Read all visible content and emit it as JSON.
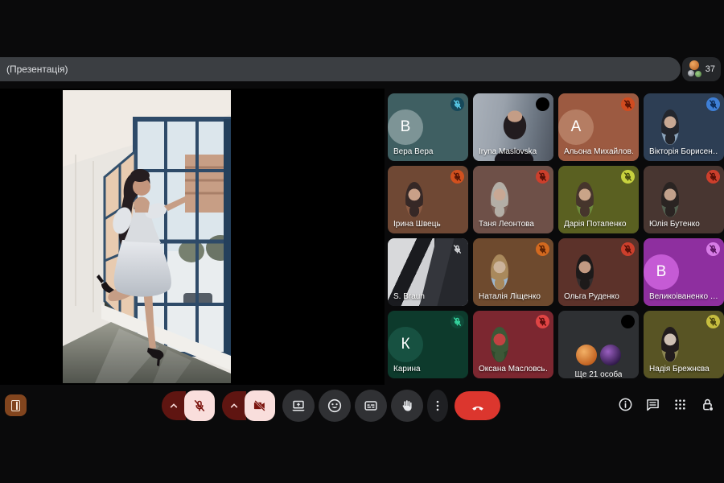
{
  "top_bar": {
    "title": "(Презентація)",
    "participants_count": "37"
  },
  "tiles": [
    {
      "name": "Вера Вера",
      "type": "initial",
      "initial": "В",
      "bg": "#3f5f62",
      "avatar_bg": "#7d9496",
      "badge": {
        "bg": "#16485a",
        "fg": "#58c8e6"
      }
    },
    {
      "name": "Iryna Maslovska",
      "type": "video",
      "video": "maslovska",
      "bg": "#6d7680"
    },
    {
      "name": "Альона Михайлов…",
      "type": "initial",
      "initial": "А",
      "bg": "#9c5a41",
      "avatar_bg": "#b57d63",
      "badge": {
        "bg": "#d14b1f",
        "fg": "#571304"
      }
    },
    {
      "name": "Вікторія Борисен…",
      "type": "photo",
      "bg": "#2d3e54",
      "photo": [
        "#c8a893",
        "#23262d",
        "#8ba3ba"
      ],
      "badge": {
        "bg": "#3e7fd6",
        "fg": "#0c2a56"
      }
    },
    {
      "name": "Ірина Швець",
      "type": "photo",
      "bg": "#6f4834",
      "photo": [
        "#c9a088",
        "#362826",
        "#8a5a42"
      ],
      "badge": {
        "bg": "#d2501e",
        "fg": "#571504"
      }
    },
    {
      "name": "Таня Леонтова",
      "type": "photo",
      "bg": "#6e5048",
      "photo": [
        "#c9a894",
        "#b3aea6",
        "#7c6057"
      ],
      "badge": {
        "bg": "#cc3f2c",
        "fg": "#520f06"
      }
    },
    {
      "name": "Дарія Потапенко",
      "type": "photo",
      "bg": "#5a6021",
      "photo": [
        "#c9a488",
        "#46352c",
        "#6d8a3c"
      ],
      "badge": {
        "bg": "#c8d23e",
        "fg": "#464a0e"
      }
    },
    {
      "name": "Юлія Бутенко",
      "type": "photo",
      "bg": "#483631",
      "photo": [
        "#c2a18b",
        "#2a2422",
        "#526050"
      ],
      "badge": {
        "bg": "#cc3f2c",
        "fg": "#520f06"
      }
    },
    {
      "name": "S. Braun",
      "type": "video",
      "video": "braun",
      "bg": "#34373c",
      "badge": {
        "bg": "none",
        "fg": "#d5d7da"
      }
    },
    {
      "name": "Наталія Ліщенко",
      "type": "photo",
      "bg": "#6e4a2e",
      "photo": [
        "#cbb39b",
        "#a9895c",
        "#9cb6cf"
      ],
      "badge": {
        "bg": "#d2691f",
        "fg": "#5a2104"
      }
    },
    {
      "name": "Ольга Руденко",
      "type": "photo",
      "bg": "#5c322a",
      "photo": [
        "#c39a82",
        "#1d1a1a",
        "#332c2c"
      ],
      "badge": {
        "bg": "#cc3f2c",
        "fg": "#520f06"
      }
    },
    {
      "name": "Великоіваненко …",
      "type": "initial",
      "initial": "В",
      "bg": "#8e2f9f",
      "avatar_bg": "#c55bd5",
      "badge": {
        "bg": "#d77ce6",
        "fg": "#58135f"
      }
    },
    {
      "name": "Карина",
      "type": "initial",
      "initial": "К",
      "bg": "#0d3a2c",
      "avatar_bg": "#175141",
      "badge": {
        "bg": "#0f4a38",
        "fg": "#35d6a0"
      }
    },
    {
      "name": "Оксана Масловсь…",
      "type": "photo",
      "bg": "#7c2730",
      "photo": [
        "#c24242",
        "#3c5837",
        "#2f4a2c"
      ],
      "badge": {
        "bg": "#e04444",
        "fg": "#570c0c"
      }
    },
    {
      "name": "Ще 21 особа",
      "type": "overflow",
      "bg": "#2e3033",
      "avatars": [
        [
          "#f2b066",
          "#c05f1e"
        ],
        [
          "#9a5fc0",
          "#30194a"
        ]
      ]
    },
    {
      "name": "Надія Брежнєва",
      "type": "photo",
      "bg": "#585424",
      "photo": [
        "#cfc0b4",
        "#221c1d",
        "#8b8552"
      ],
      "badge": {
        "bg": "#c6bd3f",
        "fg": "#48430e"
      }
    }
  ],
  "toolbar": {
    "left_app_icon": "door-icon",
    "controls": [
      {
        "name": "mic-expand",
        "icon": "chevron-up-icon"
      },
      {
        "name": "mic-toggle",
        "icon": "mic-off-icon",
        "state": "muted"
      },
      {
        "name": "camera-expand",
        "icon": "chevron-up-icon"
      },
      {
        "name": "camera-toggle",
        "icon": "camera-off-icon",
        "state": "off"
      },
      {
        "name": "present-screen",
        "icon": "present-screen-icon"
      },
      {
        "name": "reactions",
        "icon": "smiley-icon"
      },
      {
        "name": "captions",
        "icon": "captions-icon"
      },
      {
        "name": "raise-hand",
        "icon": "raise-hand-icon"
      },
      {
        "name": "more-options",
        "icon": "three-dots-icon"
      },
      {
        "name": "end-call",
        "icon": "phone-down-icon"
      }
    ],
    "right": [
      {
        "name": "meeting-details",
        "icon": "info-icon"
      },
      {
        "name": "chat",
        "icon": "chat-icon"
      },
      {
        "name": "activities",
        "icon": "apps-grid-icon"
      },
      {
        "name": "host-controls",
        "icon": "lock-icon"
      }
    ]
  },
  "colors": {
    "end_call": "#dc362e",
    "muted_light": "#f9dedc",
    "muted_dark": "#5f1511",
    "muted_icon": "#7c150f",
    "bar_bg": "#3b3e42",
    "button_bg": "#303134",
    "icon": "#e8eaed"
  }
}
